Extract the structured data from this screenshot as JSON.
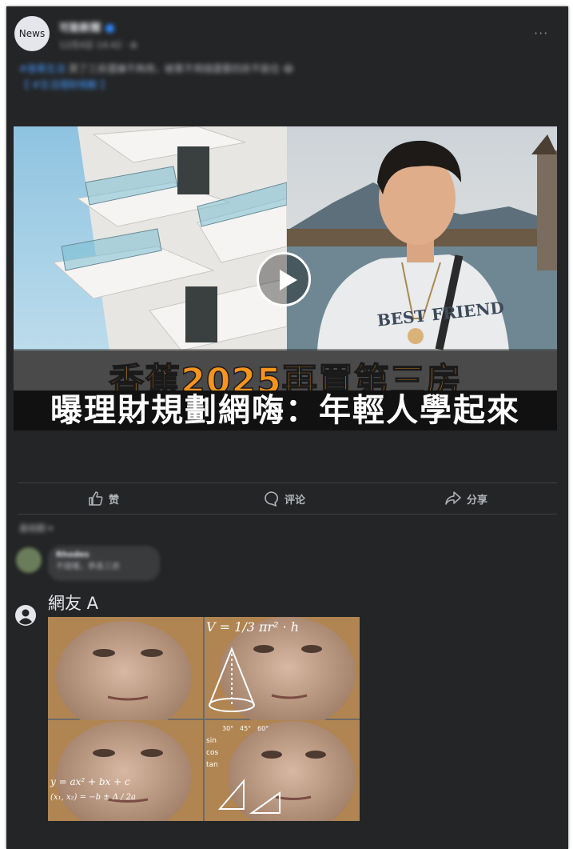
{
  "post": {
    "avatar_text": "News",
    "page_name": "可能新聞",
    "meta": "12月4日 14:42 · ⊕",
    "caption_link": "#香蕉生活",
    "caption_text": "買了三房還嫌不夠用，被罵不用錢還要四房不能住 😂",
    "caption_more": "【 #生活理財規劃 】"
  },
  "video": {
    "headline_line1": "香蕉2025再買第三房",
    "headline_line2": "曝理財規劃網嗨：年輕人學起來",
    "shirt_text": "BEST FRIEND"
  },
  "actions": {
    "like": "赞",
    "comment": "评论",
    "share": "分享"
  },
  "comments": {
    "sort_label": "最相關 ▾",
    "blurred_name": "Rhodes",
    "blurred_text": "不錯喔，恭喜三房",
    "commenter_name": "網友 A"
  },
  "meme": {
    "formula_top": "V = 1/3 πr² · h",
    "formula_bottom1": "y = ax² + bx + c",
    "formula_bottom2": "(x₁, x₂) = −b ± Δ / 2a",
    "trig_labels": [
      "sin",
      "cos",
      "tan"
    ],
    "angles": [
      "30°",
      "45°",
      "60°"
    ]
  },
  "colors": {
    "frame_bg": "#242526",
    "text_secondary": "#b0b3b8",
    "headline_orange": "#f7941d",
    "link_blue": "#4599ff"
  }
}
